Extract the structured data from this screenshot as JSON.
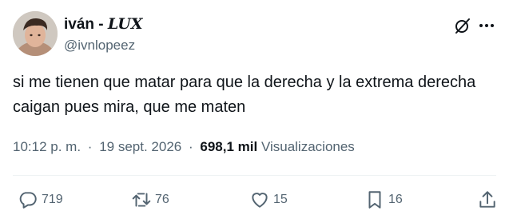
{
  "user": {
    "display_name": "iván - ",
    "display_name_styled": "LUX",
    "handle": "@ivnlopeez",
    "avatar_icon": "profile-photo"
  },
  "tweet": {
    "text": "si me tienen que matar para que la derecha y la extrema derecha caigan pues mira, que me maten"
  },
  "meta": {
    "time": "10:12 p. m.",
    "separator": "·",
    "date": "19 sept. 2026",
    "views_count": "698,1 mil",
    "views_label": "Visualizaciones"
  },
  "actions": {
    "replies": "719",
    "retweets": "76",
    "likes": "15",
    "bookmarks": "16"
  },
  "icons": {
    "grok": "grok-icon",
    "more": "more-icon",
    "reply": "reply-icon",
    "retweet": "retweet-icon",
    "like": "heart-icon",
    "bookmark": "bookmark-icon",
    "share": "share-icon"
  },
  "colors": {
    "text_primary": "#0f1419",
    "text_secondary": "#536471",
    "divider": "#eff3f4"
  }
}
